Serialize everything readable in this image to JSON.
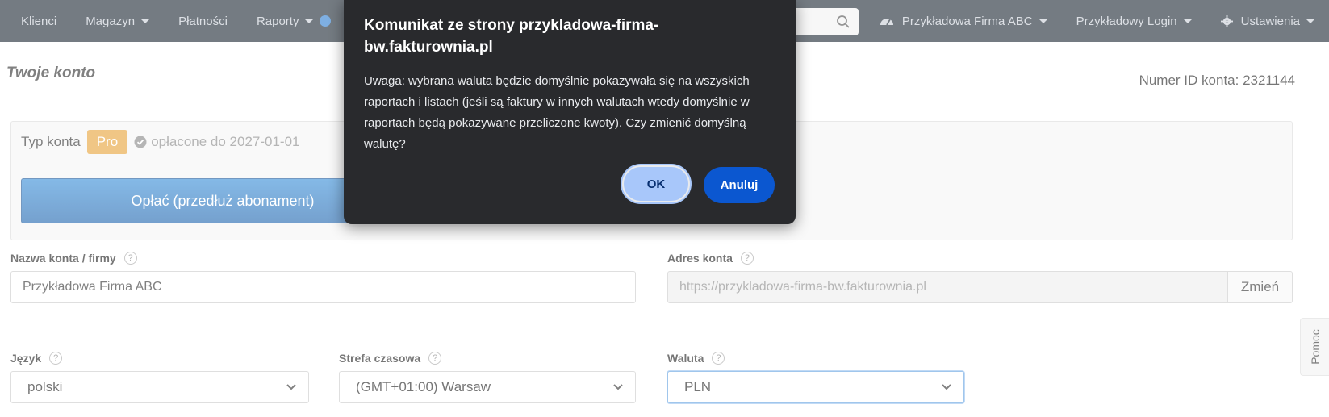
{
  "navbar": {
    "items_left": [
      {
        "label": "Klienci",
        "dropdown": false
      },
      {
        "label": "Magazyn",
        "dropdown": true
      },
      {
        "label": "Płatności",
        "dropdown": false
      },
      {
        "label": "Raporty",
        "dropdown": true
      }
    ],
    "company": "Przykładowa Firma ABC",
    "login": "Przykładowy Login",
    "settings": "Ustawienia"
  },
  "page": {
    "title": "Twoje konto",
    "account_id": "Numer ID konta: 2321144",
    "account_type_label": "Typ konta",
    "account_type_badge": "Pro",
    "paid_until": "opłacone do 2027-01-01",
    "pay_button": "Opłać (przedłuż abonament)"
  },
  "form": {
    "company_name_label": "Nazwa konta / firmy",
    "company_name_value": "Przykładowa Firma ABC",
    "address_label": "Adres konta",
    "address_value": "https://przykladowa-firma-bw.fakturownia.pl",
    "change_button": "Zmień",
    "language_label": "Język",
    "language_value": "polski",
    "timezone_label": "Strefa czasowa",
    "timezone_value": "(GMT+01:00) Warsaw",
    "currency_label": "Waluta",
    "currency_value": "PLN",
    "help_glyph": "?"
  },
  "help_tab": "Pomoc",
  "dialog": {
    "title": "Komunikat ze strony przykladowa-firma-bw.fakturownia.pl",
    "message": "Uwaga: wybrana waluta będzie domyślnie pokazywała się na wszyskich raportach i listach (jeśli są faktury w innych walutach wtedy domyślnie w raportach będą pokazywane przeliczone kwoty). Czy zmienić domyślną walutę?",
    "ok_button": "OK",
    "cancel_button": "Anuluj"
  },
  "colors": {
    "navbar_bg": "#1f2a36",
    "pro_badge": "#e7a33a",
    "pay_button": "#2a78c6",
    "dialog_bg": "#292a2d",
    "ok_button": "#a8c7fa",
    "cancel_button": "#0b57d0"
  }
}
